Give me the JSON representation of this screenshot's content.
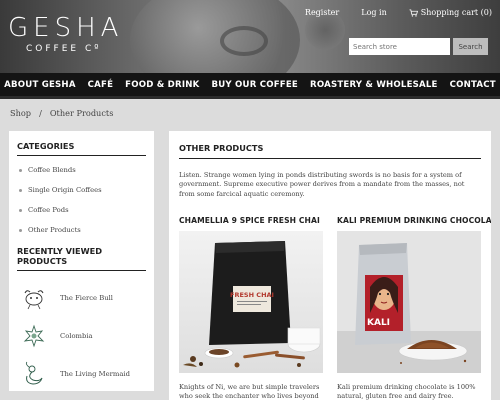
{
  "brand": {
    "name": "GESHA",
    "sub": "COFFEE Cº"
  },
  "toplinks": {
    "register": "Register",
    "login": "Log in",
    "cart": "Shopping cart (0)"
  },
  "search": {
    "placeholder": "Search store",
    "button": "Search"
  },
  "nav": [
    "ABOUT GESHA",
    "CAFÉ",
    "FOOD & DRINK",
    "BUY OUR COFFEE",
    "ROASTERY & WHOLESALE",
    "CONTACT"
  ],
  "breadcrumb": {
    "home": "Shop",
    "sep": "/",
    "current": "Other Products"
  },
  "sidebar": {
    "categories_title": "CATEGORIES",
    "categories": [
      "Coffee Blends",
      "Single Origin Coffees",
      "Coffee Pods",
      "Other Products"
    ],
    "recent_title": "RECENTLY VIEWED PRODUCTS",
    "recent": [
      "The Fierce Bull",
      "Colombia",
      "The Living Mermaid"
    ]
  },
  "main": {
    "title": "OTHER PRODUCTS",
    "description": "Listen. Strange women lying in ponds distributing swords is no basis for a system of government. Supreme executive power derives from a mandate from the masses, not from some farcical aquatic ceremony.",
    "products": [
      {
        "title": "CHAMELLIA 9 SPICE FRESH CHAI",
        "desc": "Knights of Ni, we are but simple travelers who seek the enchanter who lives beyond these",
        "bag_label": "FRESH CHAI"
      },
      {
        "title": "KALI PREMIUM DRINKING CHOCOLATE",
        "desc": "Kali premium drinking chocolate is 100% natural, gluten free and dairy free.",
        "bag_label": "KALI"
      }
    ]
  },
  "colors": {
    "nav_bg": "#141414",
    "panel_bg": "#ffffff",
    "page_bg": "#dcdcdc",
    "kali_red": "#b3202a"
  }
}
